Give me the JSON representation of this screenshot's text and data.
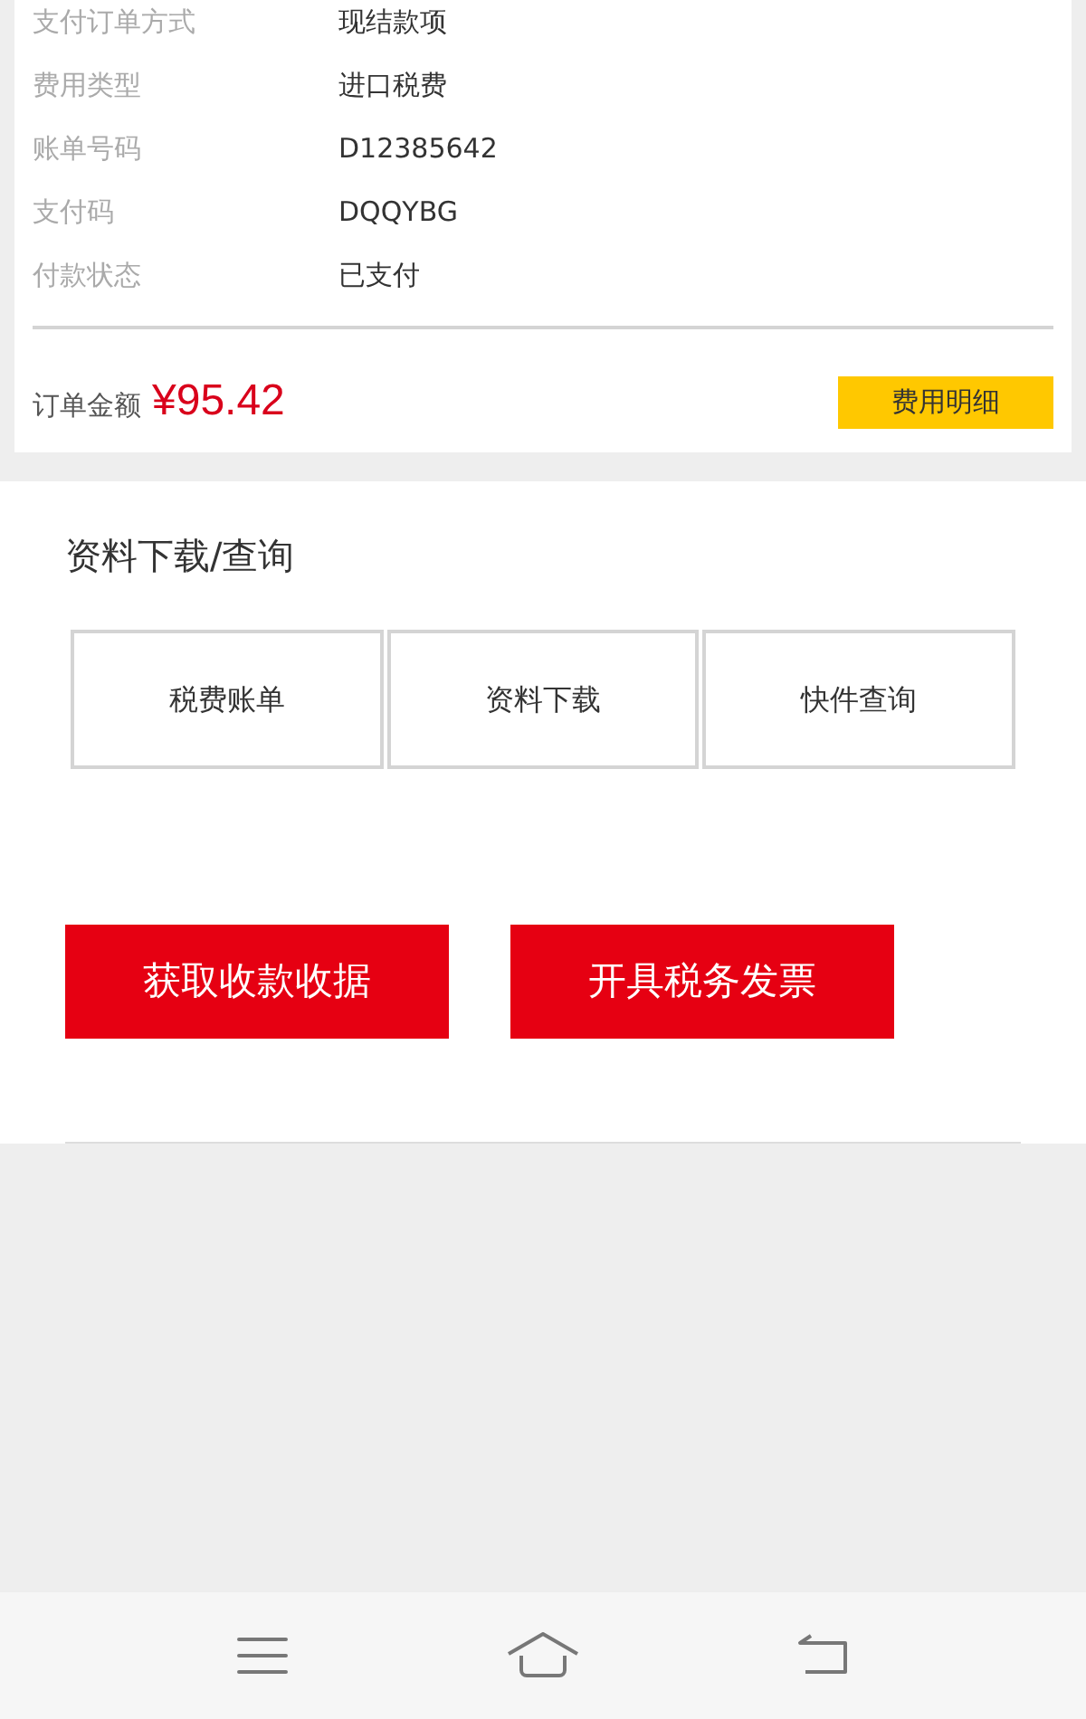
{
  "order_details": [
    {
      "label": "支付订单方式",
      "value": "现结款项"
    },
    {
      "label": "费用类型",
      "value": "进口税费"
    },
    {
      "label": "账单号码",
      "value": "D12385642"
    },
    {
      "label": "支付码",
      "value": "DQQYBG"
    },
    {
      "label": "付款状态",
      "value": "已支付"
    }
  ],
  "amount": {
    "label": "订单金额",
    "value": "¥95.42",
    "button": "费用明细"
  },
  "downloads": {
    "title": "资料下载/查询",
    "items": [
      "税费账单",
      "资料下载",
      "快件查询"
    ]
  },
  "actions": [
    "获取收款收据",
    "开具税务发票"
  ]
}
